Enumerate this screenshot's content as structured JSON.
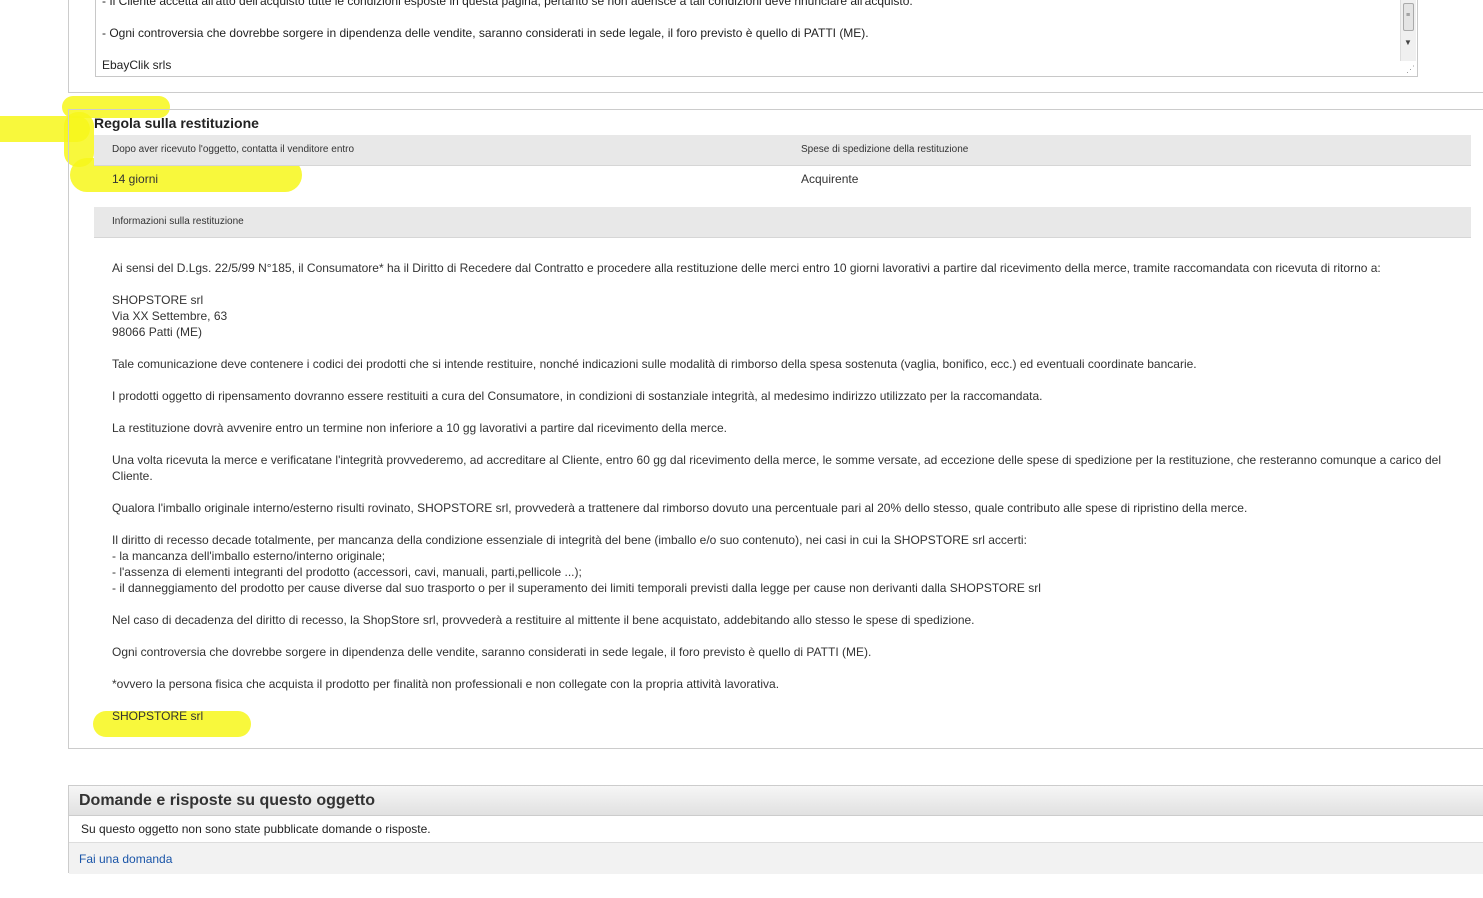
{
  "terms_textarea": {
    "line1": "-  Il Cliente accetta all'atto dell'acquisto tutte le condizioni esposte in questa pagina, pertanto se non aderisce a tali condizioni deve rinunciare all'acquisto.",
    "line2": "- Ogni controversia che dovrebbe sorgere in dipendenza delle vendite, saranno considerati in sede legale, il foro previsto è quello di PATTI (ME).",
    "line3": "EbayClik srls"
  },
  "return_policy": {
    "title": "Regola sulla restituzione",
    "contact_header": "Dopo aver ricevuto l'oggetto, contatta il venditore entro",
    "contact_value": "14 giorni",
    "shipping_header": "Spese di spedizione della restituzione",
    "shipping_value": "Acquirente",
    "info_header": "Informazioni sulla restituzione",
    "paragraphs": [
      "Ai sensi del D.Lgs. 22/5/99 N°185, il Consumatore* ha il Diritto di Recedere dal Contratto e procedere alla restituzione delle merci entro 10 giorni lavorativi a partire dal ricevimento della merce, tramite raccomandata con ricevuta di ritorno a:",
      "SHOPSTORE srl\nVia XX Settembre, 63\n98066 Patti (ME)",
      "Tale comunicazione deve contenere i codici dei prodotti che si intende restituire, nonché indicazioni sulle modalità di rimborso della spesa sostenuta (vaglia, bonifico, ecc.) ed eventuali coordinate bancarie.",
      "I prodotti oggetto di ripensamento dovranno essere restituiti a cura del Consumatore, in condizioni di sostanziale integrità, al medesimo indirizzo utilizzato per la raccomandata.",
      "La restituzione dovrà avvenire entro un termine non inferiore a 10 gg lavorativi a partire dal ricevimento della merce.",
      "Una volta ricevuta la merce e verificatane l'integrità provvederemo, ad accreditare al Cliente, entro 60 gg dal ricevimento della merce, le somme versate, ad eccezione delle spese di spedizione per la restituzione, che resteranno comunque a carico del Cliente.",
      "Qualora l'imballo originale interno/esterno risulti rovinato, SHOPSTORE srl, provvederà a trattenere dal rimborso dovuto una percentuale pari al 20% dello stesso, quale contributo alle spese di ripristino della merce.",
      "Il diritto di recesso decade totalmente, per mancanza della condizione essenziale di integrità del bene (imballo e/o suo contenuto), nei casi in cui la SHOPSTORE srl accerti:\n- la mancanza dell'imballo esterno/interno originale;\n- l'assenza di elementi integranti del prodotto (accessori, cavi, manuali, parti,pellicole ...);\n- il danneggiamento del prodotto per cause diverse dal suo trasporto o per il superamento dei limiti temporali previsti dalla legge per cause non derivanti dalla SHOPSTORE srl",
      "Nel caso di decadenza del diritto di recesso, la ShopStore srl, provvederà a restituire al mittente il bene acquistato, addebitando allo stesso le spese di spedizione.",
      "Ogni controversia che dovrebbe sorgere in dipendenza delle vendite, saranno considerati in sede legale, il foro previsto è quello di PATTI (ME).",
      "*ovvero la persona fisica che acquista il prodotto per finalità non professionali e non collegate con la propria attività lavorativa.",
      "SHOPSTORE srl"
    ]
  },
  "qa": {
    "title": "Domande e risposte su questo oggetto",
    "empty_text": "Su questo oggetto non sono state pubblicate domande o risposte.",
    "ask_link": "Fai una domanda"
  },
  "highlight_color": "#f7f71a"
}
